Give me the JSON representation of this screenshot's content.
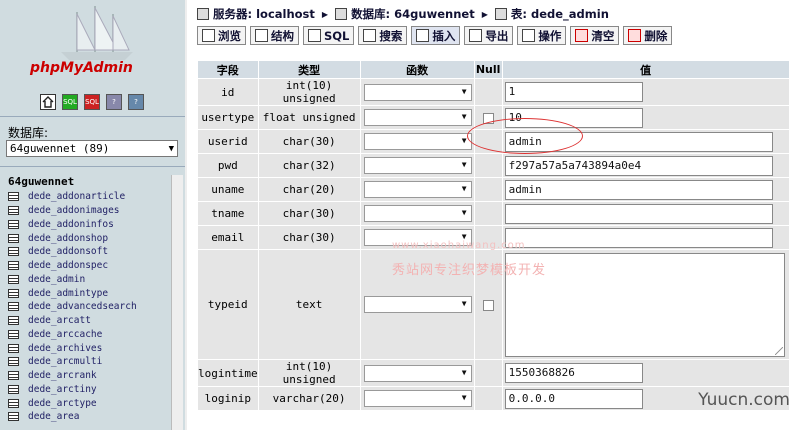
{
  "left": {
    "logo": {
      "text_left": "php",
      "text_right": "MyAdmin"
    },
    "toolbar_icons": [
      "home-icon",
      "sql-window-icon",
      "sql-query-icon",
      "docs-icon",
      "help-icon"
    ],
    "db_label": "数据库:",
    "db_select_value": "64guwennet (89)",
    "db_title": "64guwennet",
    "tables": [
      "dede_addonarticle",
      "dede_addonimages",
      "dede_addoninfos",
      "dede_addonshop",
      "dede_addonsoft",
      "dede_addonspec",
      "dede_admin",
      "dede_admintype",
      "dede_advancedsearch",
      "dede_arcatt",
      "dede_arccache",
      "dede_archives",
      "dede_arcmulti",
      "dede_arcrank",
      "dede_arctiny",
      "dede_arctype",
      "dede_area"
    ]
  },
  "breadcrumb": {
    "server_label": "服务器:",
    "server": "localhost",
    "db_label": "数据库:",
    "db": "64guwennet",
    "table_label": "表:",
    "table": "dede_admin"
  },
  "tabs": [
    {
      "label": "浏览",
      "icon": "browse-icon"
    },
    {
      "label": "结构",
      "icon": "structure-icon"
    },
    {
      "label": "SQL",
      "icon": "sql-icon"
    },
    {
      "label": "搜索",
      "icon": "search-icon"
    },
    {
      "label": "插入",
      "icon": "insert-icon"
    },
    {
      "label": "导出",
      "icon": "export-icon"
    },
    {
      "label": "操作",
      "icon": "operations-icon"
    },
    {
      "label": "清空",
      "icon": "empty-icon"
    },
    {
      "label": "删除",
      "icon": "drop-icon"
    }
  ],
  "table": {
    "headers": {
      "field": "字段",
      "type": "类型",
      "function": "函数",
      "null": "Null",
      "value": "值"
    },
    "rows": [
      {
        "field": "id",
        "type": "int(10) unsigned",
        "has_null": false,
        "value": "1",
        "input": "short"
      },
      {
        "field": "usertype",
        "type": "float unsigned",
        "has_null": true,
        "value": "10",
        "input": "short"
      },
      {
        "field": "userid",
        "type": "char(30)",
        "has_null": false,
        "value": "admin",
        "input": "long"
      },
      {
        "field": "pwd",
        "type": "char(32)",
        "has_null": false,
        "value": "f297a57a5a743894a0e4",
        "input": "long"
      },
      {
        "field": "uname",
        "type": "char(20)",
        "has_null": false,
        "value": "admin",
        "input": "long"
      },
      {
        "field": "tname",
        "type": "char(30)",
        "has_null": false,
        "value": "",
        "input": "long"
      },
      {
        "field": "email",
        "type": "char(30)",
        "has_null": false,
        "value": "",
        "input": "long"
      },
      {
        "field": "typeid",
        "type": "text",
        "has_null": true,
        "value": "",
        "input": "textarea"
      },
      {
        "field": "logintime",
        "type": "int(10) unsigned",
        "has_null": false,
        "value": "1550368826",
        "input": "short"
      },
      {
        "field": "loginip",
        "type": "varchar(20)",
        "has_null": false,
        "value": "0.0.0.0",
        "input": "short"
      }
    ]
  },
  "watermarks": {
    "url": "www.xiaohaiwang.com",
    "slogan": "秀站网专注织梦模板开发",
    "site": "Yuucn.com"
  },
  "colors": {
    "header_bg": "#d3dce3",
    "row_bg": "#e5e5e5",
    "left_bg": "#d0dce0",
    "highlight": "#dd3333"
  }
}
